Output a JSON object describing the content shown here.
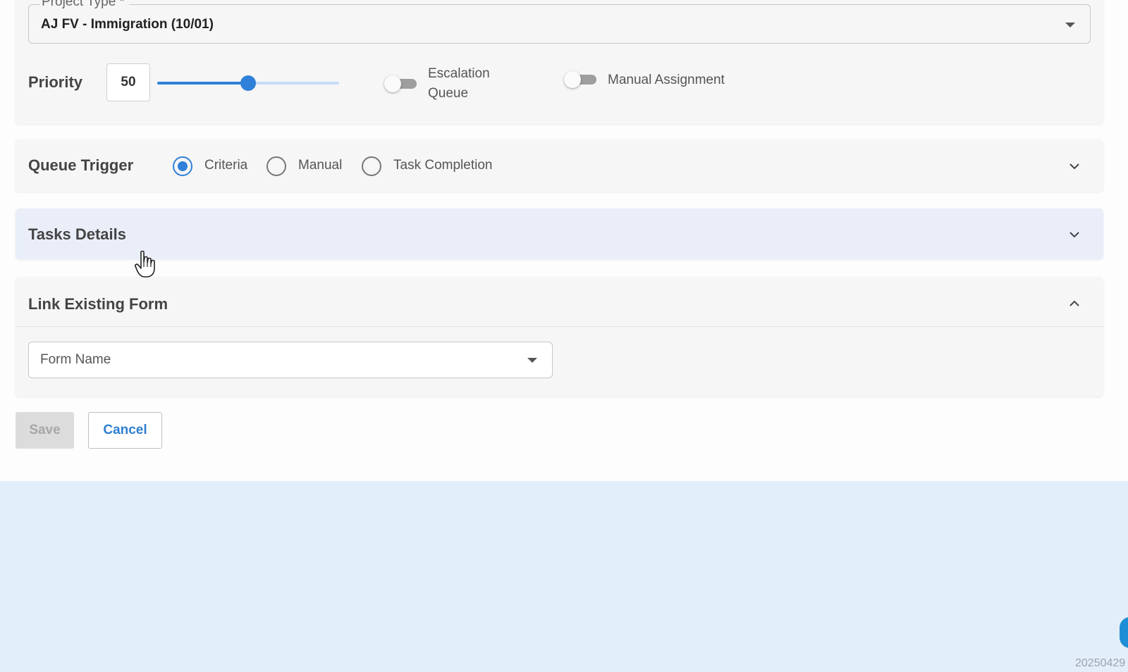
{
  "project_type": {
    "label": "Project Type *",
    "value": "AJ FV - Immigration (10/01)"
  },
  "priority": {
    "label": "Priority",
    "value": "50",
    "slider_fraction": 0.5
  },
  "toggles": {
    "escalation_queue_line1": "Escalation",
    "escalation_queue_line2": "Queue",
    "escalation_queue_on": false,
    "manual_assignment": "Manual Assignment",
    "manual_assignment_on": false
  },
  "queue_trigger": {
    "title": "Queue Trigger",
    "options": [
      "Criteria",
      "Manual",
      "Task Completion"
    ],
    "selected": "Criteria"
  },
  "tasks_details": {
    "title": "Tasks Details"
  },
  "link_existing_form": {
    "title": "Link Existing Form",
    "form_name_placeholder": "Form Name"
  },
  "actions": {
    "save": "Save",
    "cancel": "Cancel"
  },
  "footer": {
    "version": "20250429"
  },
  "colors": {
    "accent": "#2f80d8",
    "bottom_band": "#e3eefb",
    "tasks_highlight": "#e9eef9"
  },
  "icons": [
    "chevron-down-icon",
    "chevron-up-icon",
    "caret-down-icon",
    "hand-pointer-cursor"
  ]
}
